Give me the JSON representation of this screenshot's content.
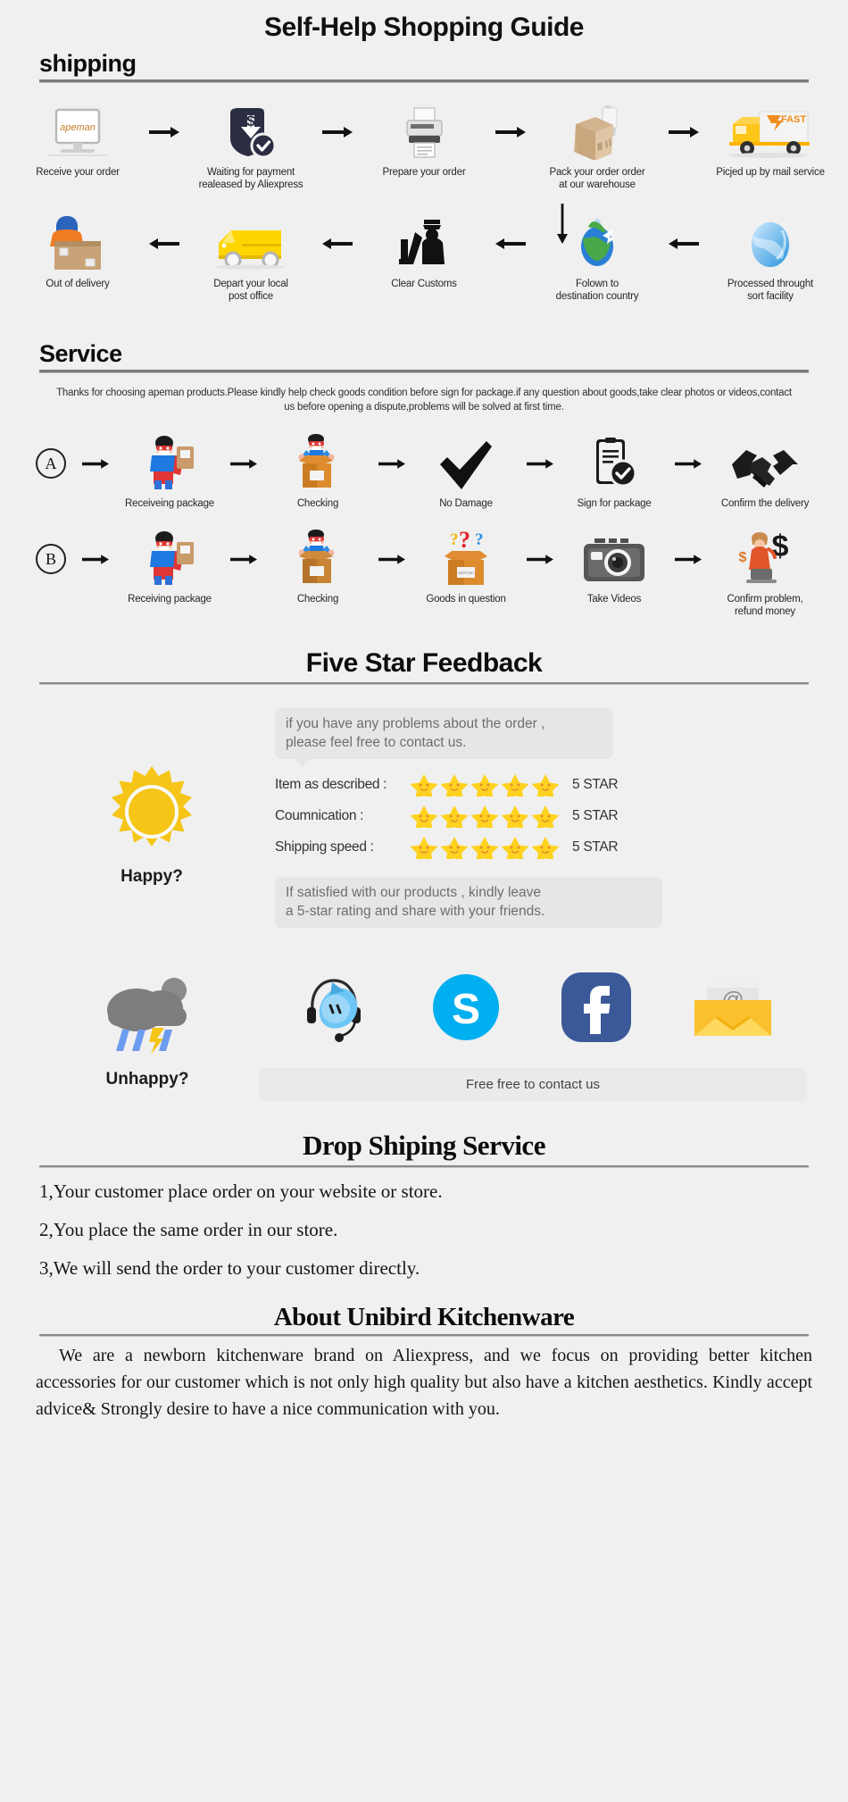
{
  "title": "Self-Help Shopping Guide",
  "sections": {
    "shipping": {
      "heading": "shipping",
      "row1": [
        {
          "caption": "Receive your order",
          "icon": "monitor-apeman-icon"
        },
        {
          "caption": "Waiting for payment\nrealeased by Aliexpress",
          "icon": "payment-shield-icon"
        },
        {
          "caption": "Prepare your order",
          "icon": "printer-icon"
        },
        {
          "caption": "Pack your order order\nat our warehouse",
          "icon": "packing-box-icon"
        },
        {
          "caption": "Picjed up by mail service",
          "icon": "delivery-truck-fast-icon"
        }
      ],
      "row2": [
        {
          "caption": "Out of delivery",
          "icon": "courier-with-box-icon"
        },
        {
          "caption": "Depart your local\npost office",
          "icon": "yellow-van-icon"
        },
        {
          "caption": "Clear Customs",
          "icon": "customs-officer-icon"
        },
        {
          "caption": "Folown to\ndestination country",
          "icon": "globe-airplane-icon"
        },
        {
          "caption": "Processed throught\nsort facility",
          "icon": "blue-globe-icon"
        }
      ]
    },
    "service": {
      "heading": "Service",
      "note": "Thanks for choosing apeman products.Please kindly help check goods condition before sign for package.if any question about goods,take clear photos or videos,contact us before opening a dispute,problems will be solved at first time.",
      "rowA": {
        "badge": "A",
        "steps": [
          {
            "caption": "Receiveing package",
            "icon": "hero-holding-parcel-icon"
          },
          {
            "caption": "Checking",
            "icon": "hero-in-open-box-icon"
          },
          {
            "caption": "No Damage",
            "icon": "checkmark-icon"
          },
          {
            "caption": "Sign for package",
            "icon": "signed-document-icon"
          },
          {
            "caption": "Confirm the delivery",
            "icon": "handshake-icon"
          }
        ]
      },
      "rowB": {
        "badge": "B",
        "steps": [
          {
            "caption": "Receiving package",
            "icon": "hero-holding-parcel-icon"
          },
          {
            "caption": "Checking",
            "icon": "hero-in-open-box-icon"
          },
          {
            "caption": "Goods in question",
            "icon": "question-box-icon"
          },
          {
            "caption": "Take Videos",
            "icon": "camera-icon"
          },
          {
            "caption": "Confirm problem,\nrefund money",
            "icon": "refund-agent-icon"
          }
        ]
      }
    },
    "feedback": {
      "heading": "Five Star Feedback",
      "bubble_top": "if you have any problems about the order ,\nplease feel free to contact us.",
      "bubble_bottom": "If satisfied with our products ,  kindly leave\na 5-star rating and share with your friends.",
      "happy_label": "Happy?",
      "unhappy_label": "Unhappy?",
      "ratings": [
        {
          "label": "Item as described :",
          "stars": 5,
          "value": "5 STAR"
        },
        {
          "label": "Coumnication :",
          "stars": 5,
          "value": "5 STAR"
        },
        {
          "label": "Shipping speed :",
          "stars": 5,
          "value": "5 STAR"
        }
      ],
      "contact_bar": "Free free to contact us",
      "contact_icons": [
        "trademanager-headset-icon",
        "skype-icon",
        "facebook-icon",
        "email-envelope-icon"
      ]
    },
    "dropship": {
      "heading": "Drop Shiping Service",
      "lines": [
        "1,Your customer place order on your website or store.",
        "2,You place the same order in our store.",
        "3,We will send the order to your customer directly."
      ]
    },
    "about": {
      "heading": "About Unibird Kitchenware",
      "body": "We are a newborn kitchenware brand on Aliexpress, and we focus on providing better kitchen accessories for our customer which is not only high quality but also have a kitchen aesthetics. Kindly accept advice& Strongly desire to have a nice communication with you."
    }
  },
  "colors": {
    "background": "#f0f0f0",
    "rule": "#7b7b7b",
    "star": "#ffd21e",
    "sun": "#f5c518",
    "skype": "#00aff0",
    "facebook": "#3b5998",
    "envelope": "#fbc02d",
    "truck": "#ffc61a"
  }
}
